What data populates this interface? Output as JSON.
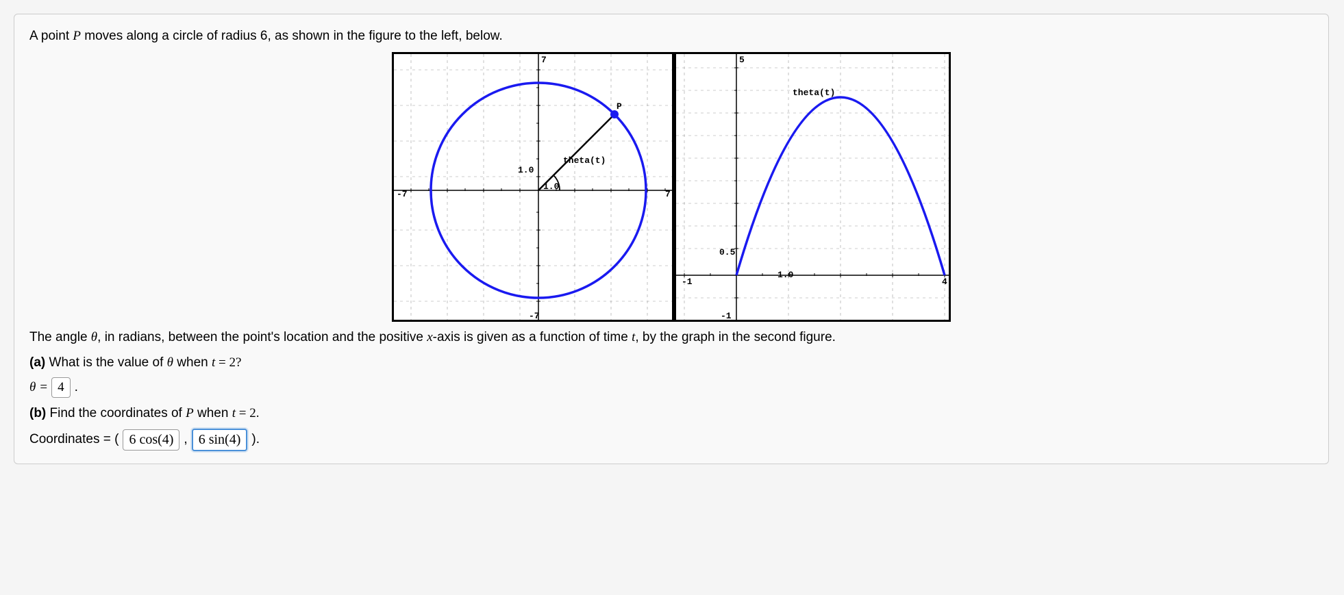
{
  "intro": "A point ",
  "intro_P": "P",
  "intro_rest": " moves along a circle of radius 6, as shown in the figure to the left, below.",
  "desc1": "The angle ",
  "desc_theta": "θ",
  "desc2": ", in radians, between the point's location and the positive ",
  "desc_x": "x",
  "desc3": "-axis is given as a function of time ",
  "desc_t": "t",
  "desc4": ", by the graph in the second figure.",
  "part_a_label": "(a)",
  "part_a_text_1": " What is the value of ",
  "part_a_theta": "θ",
  "part_a_text_2": " when ",
  "part_a_t": "t",
  "part_a_eq": " = 2?",
  "answer_a_label_theta": "θ",
  "answer_a_eq": " = ",
  "answer_a_value": "4",
  "answer_a_period": ".",
  "part_b_label": "(b)",
  "part_b_text_1": " Find the coordinates of ",
  "part_b_P": "P",
  "part_b_text_2": " when ",
  "part_b_t": "t",
  "part_b_eq": " = 2.",
  "coords_label": "Coordinates = (",
  "coords_x": "6 cos(4)",
  "coords_comma": ",",
  "coords_y": "6 sin(4)",
  "coords_close": ").",
  "chart_data": [
    {
      "type": "circle-parametric",
      "title": "",
      "xlim": [
        -7,
        7
      ],
      "ylim": [
        -7,
        7
      ],
      "circle_radius": 6,
      "circle_center": [
        0,
        0
      ],
      "point_P": {
        "angle_deg": 45,
        "label": "P"
      },
      "angle_label": "theta(t)",
      "axis_ticks": {
        "step": 1.0,
        "major_labels": [
          "1.0",
          "1.0"
        ]
      },
      "axis_labels": {
        "x_neg": "-7",
        "x_pos": "7",
        "y_pos": "7",
        "y_neg": "-7"
      }
    },
    {
      "type": "line",
      "title": "",
      "xlabel": "",
      "ylabel": "",
      "xlim": [
        -1,
        4
      ],
      "ylim": [
        -1,
        5
      ],
      "curve_label": "theta(t)",
      "axis_ticks": {
        "x_step": 1.0,
        "y_step": 0.5
      },
      "labeled_ticks": {
        "x": [
          "-1",
          "1.0",
          "4"
        ],
        "y": [
          "-1",
          "0.5",
          "5"
        ]
      },
      "series": [
        {
          "name": "theta(t)",
          "x": [
            0,
            0.5,
            1.0,
            1.5,
            2.0,
            2.5,
            3.0,
            3.5,
            4.0
          ],
          "y": [
            0,
            1.75,
            3.0,
            3.75,
            4.0,
            3.75,
            3.0,
            1.75,
            0
          ]
        }
      ]
    }
  ]
}
